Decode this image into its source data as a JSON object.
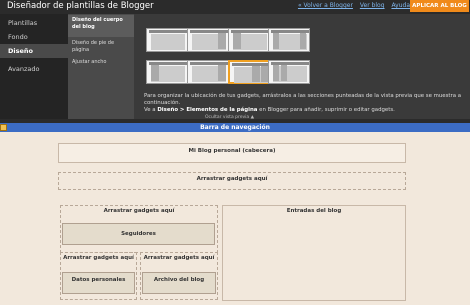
{
  "header": {
    "title": "Diseñador de plantillas de Blogger",
    "links": [
      "« Volver a Blogger",
      "Ver blog",
      "Ayuda"
    ],
    "apply_label": "APLICAR AL BLOG"
  },
  "left_nav": {
    "items": [
      {
        "label": "Plantillas",
        "active": false
      },
      {
        "label": "Fondo",
        "active": false
      },
      {
        "label": "Diseño",
        "active": true
      },
      {
        "label": "Avanzado",
        "active": false
      }
    ]
  },
  "sub_nav": {
    "items": [
      {
        "label": "Diseño del cuerpo del blog",
        "active": true
      },
      {
        "label": "Diseño de pie de página",
        "active": false
      },
      {
        "label": "Ajustar ancho",
        "active": false
      }
    ]
  },
  "layouts": {
    "selected_index": 6,
    "thumbnail_icon": "layout-thumbnail-icon"
  },
  "hint": {
    "line1": "Para organizar la ubicación de tus gadgets, arrástralos a las secciones punteadas de la vista previa que se muestra a continuación.",
    "line2_prefix": "Ve a ",
    "line2_bold": "Diseño > Elementos de la página",
    "line2_suffix": " en Blogger para añadir, suprimir o editar gadgets."
  },
  "preview": {
    "hide_label": "Ocultar vista previa ▲",
    "navbar_label": "Barra de navegación",
    "header_label": "Mi Blog personal (cabecera)",
    "drag_label": "Arrastrar gadgets aquí",
    "followers_label": "Seguidores",
    "profile_label": "Datos personales",
    "archive_label": "Archivo del blog",
    "posts_label": "Entradas del blog"
  },
  "colors": {
    "accent": "#f08a1a",
    "navbar": "#3c6cc4",
    "preview_bg": "#f2e8dc"
  }
}
